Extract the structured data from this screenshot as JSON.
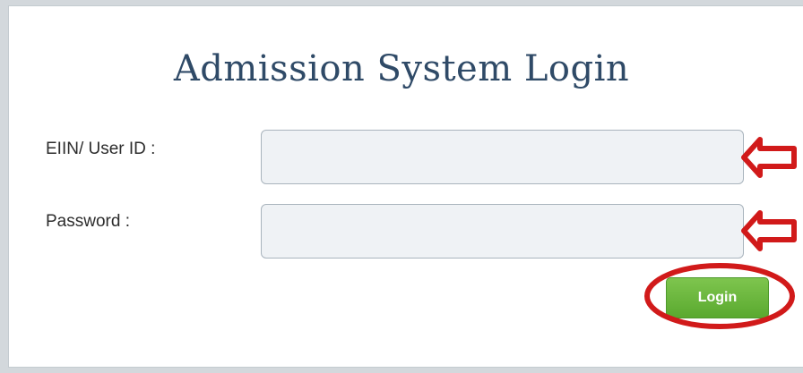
{
  "form": {
    "title": "Admission System Login",
    "user_id_label": "EIIN/ User ID :",
    "user_id_value": "",
    "password_label": "Password :",
    "password_value": "",
    "login_label": "Login"
  },
  "colors": {
    "title": "#2f4a67",
    "login_button": "#6ab83d",
    "annotation": "#d11a1a"
  }
}
